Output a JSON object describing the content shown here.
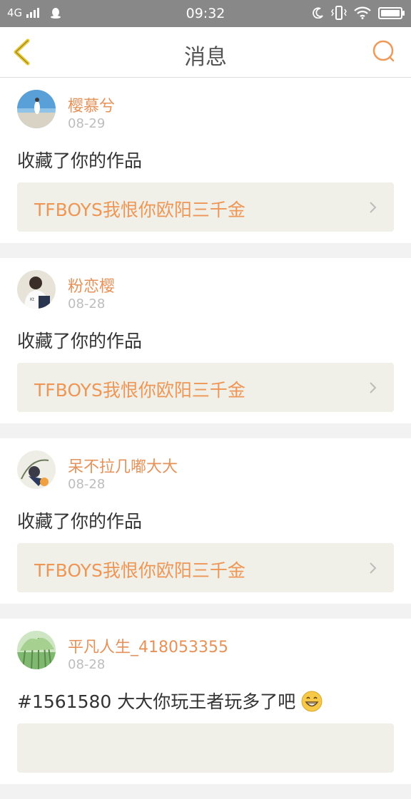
{
  "status_bar": {
    "network": "4G",
    "time": "09:32",
    "battery_level": 0.85
  },
  "header": {
    "title": "消息"
  },
  "messages": [
    {
      "username": "樱慕兮",
      "date": "08-29",
      "content": "收藏了你的作品",
      "work_title": "TFBOYS我恨你欧阳三千金"
    },
    {
      "username": "粉恋樱",
      "date": "08-28",
      "content": "收藏了你的作品",
      "work_title": "TFBOYS我恨你欧阳三千金"
    },
    {
      "username": "呆不拉几嘟大大",
      "date": "08-28",
      "content": "收藏了你的作品",
      "work_title": "TFBOYS我恨你欧阳三千金"
    },
    {
      "username": "平凡人生_418053355",
      "date": "08-28",
      "content": "#1561580 大大你玩王者玩多了吧",
      "content_emoji": "grinning-face-emoji",
      "work_title": ""
    }
  ],
  "colors": {
    "accent": "#e5925a",
    "status_bar": "#888888",
    "link_bg": "#f0f0e8"
  }
}
